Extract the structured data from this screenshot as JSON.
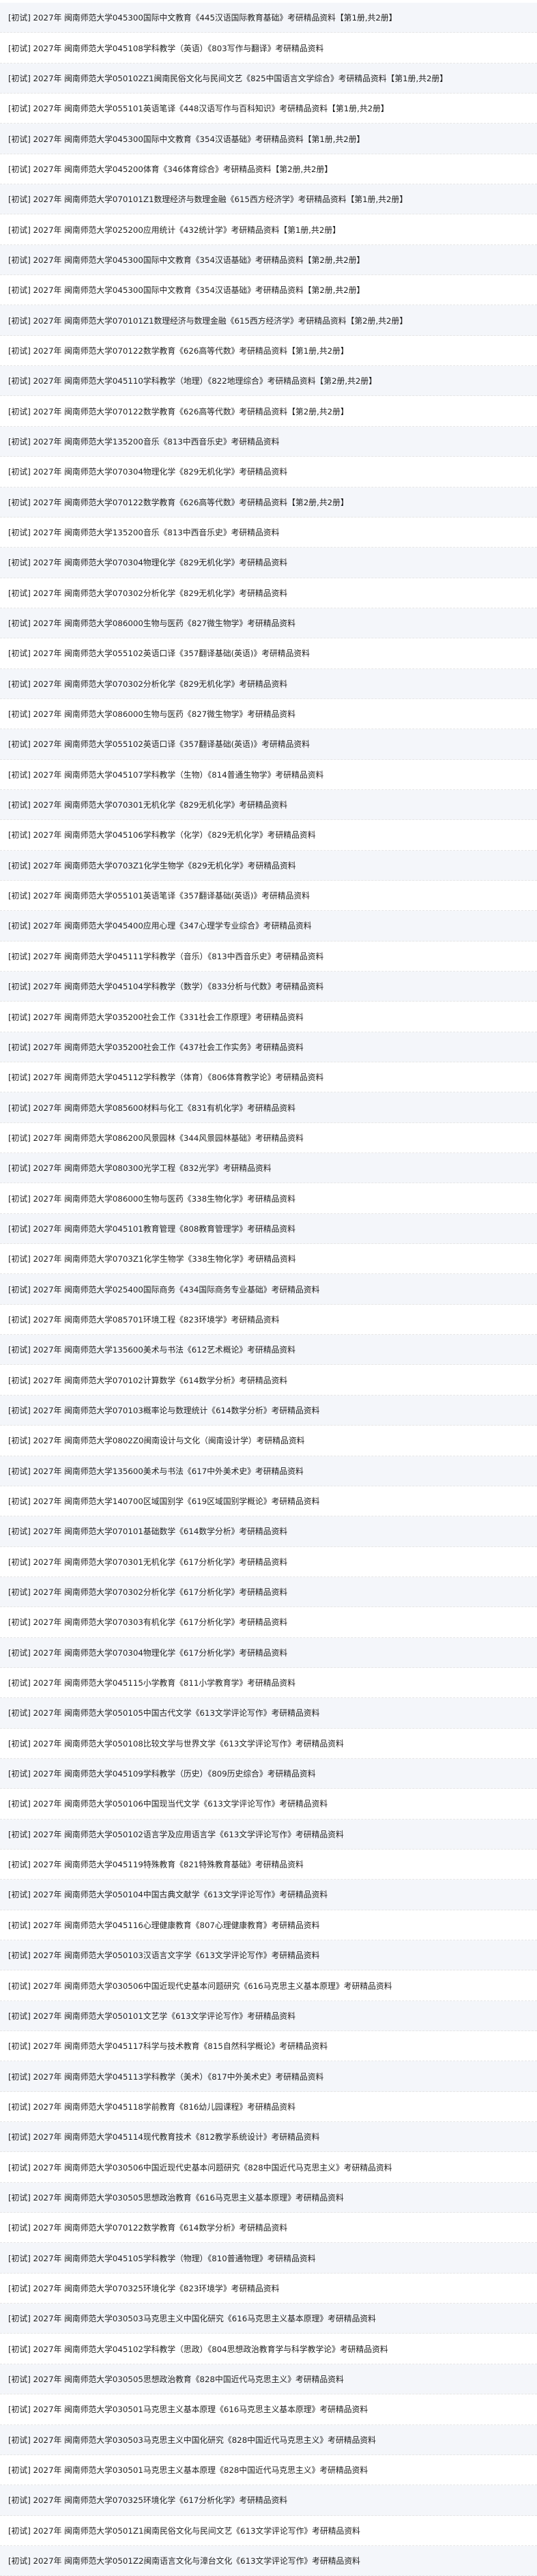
{
  "list": {
    "items": [
      "[初试] 2027年 闽南师范大学045300国际中文教育《445汉语国际教育基础》考研精品资料【第1册,共2册】",
      "[初试] 2027年 闽南师范大学045108学科教学（英语）《803写作与翻译》考研精品资料",
      "[初试] 2027年 闽南师范大学050102Z1闽南民俗文化与民间文艺《825中国语言文学综合》考研精品资料【第1册,共2册】",
      "[初试] 2027年 闽南师范大学055101英语笔译《448汉语写作与百科知识》考研精品资料【第1册,共2册】",
      "[初试] 2027年 闽南师范大学045300国际中文教育《354汉语基础》考研精品资料【第1册,共2册】",
      "[初试] 2027年 闽南师范大学045200体育《346体育综合》考研精品资料【第2册,共2册】",
      "[初试] 2027年 闽南师范大学070101Z1数理经济与数理金融《615西方经济学》考研精品资料【第1册,共2册】",
      "[初试] 2027年 闽南师范大学025200应用统计《432统计学》考研精品资料【第1册,共2册】",
      "[初试] 2027年 闽南师范大学045300国际中文教育《354汉语基础》考研精品资料【第2册,共2册】",
      "[初试] 2027年 闽南师范大学045300国际中文教育《354汉语基础》考研精品资料【第2册,共2册】",
      "[初试] 2027年 闽南师范大学070101Z1数理经济与数理金融《615西方经济学》考研精品资料【第2册,共2册】",
      "[初试] 2027年 闽南师范大学070122数学教育《626高等代数》考研精品资料【第1册,共2册】",
      "[初试] 2027年 闽南师范大学045110学科教学（地理）《822地理综合》考研精品资料【第2册,共2册】",
      "[初试] 2027年 闽南师范大学070122数学教育《626高等代数》考研精品资料【第2册,共2册】",
      "[初试] 2027年 闽南师范大学135200音乐《813中西音乐史》考研精品资料",
      "[初试] 2027年 闽南师范大学070304物理化学《829无机化学》考研精品资料",
      "[初试] 2027年 闽南师范大学070122数学教育《626高等代数》考研精品资料【第2册,共2册】",
      "[初试] 2027年 闽南师范大学135200音乐《813中西音乐史》考研精品资料",
      "[初试] 2027年 闽南师范大学070304物理化学《829无机化学》考研精品资料",
      "[初试] 2027年 闽南师范大学070302分析化学《829无机化学》考研精品资料",
      "[初试] 2027年 闽南师范大学086000生物与医药《827微生物学》考研精品资料",
      "[初试] 2027年 闽南师范大学055102英语口译《357翻译基础(英语)》考研精品资料",
      "[初试] 2027年 闽南师范大学070302分析化学《829无机化学》考研精品资料",
      "[初试] 2027年 闽南师范大学086000生物与医药《827微生物学》考研精品资料",
      "[初试] 2027年 闽南师范大学055102英语口译《357翻译基础(英语)》考研精品资料",
      "[初试] 2027年 闽南师范大学045107学科教学（生物）《814普通生物学》考研精品资料",
      "[初试] 2027年 闽南师范大学070301无机化学《829无机化学》考研精品资料",
      "[初试] 2027年 闽南师范大学045106学科教学（化学）《829无机化学》考研精品资料",
      "[初试] 2027年 闽南师范大学0703Z1化学生物学《829无机化学》考研精品资料",
      "[初试] 2027年 闽南师范大学055101英语笔译《357翻译基础(英语)》考研精品资料",
      "[初试] 2027年 闽南师范大学045400应用心理《347心理学专业综合》考研精品资料",
      "[初试] 2027年 闽南师范大学045111学科教学（音乐）《813中西音乐史》考研精品资料",
      "[初试] 2027年 闽南师范大学045104学科教学（数学）《833分析与代数》考研精品资料",
      "[初试] 2027年 闽南师范大学035200社会工作《331社会工作原理》考研精品资料",
      "[初试] 2027年 闽南师范大学035200社会工作《437社会工作实务》考研精品资料",
      "[初试] 2027年 闽南师范大学045112学科教学（体育）《806体育教学论》考研精品资料",
      "[初试] 2027年 闽南师范大学085600材料与化工《831有机化学》考研精品资料",
      "[初试] 2027年 闽南师范大学086200风景园林《344风景园林基础》考研精品资料",
      "[初试] 2027年 闽南师范大学080300光学工程《832光学》考研精品资料",
      "[初试] 2027年 闽南师范大学086000生物与医药《338生物化学》考研精品资料",
      "[初试] 2027年 闽南师范大学045101教育管理《808教育管理学》考研精品资料",
      "[初试] 2027年 闽南师范大学0703Z1化学生物学《338生物化学》考研精品资料",
      "[初试] 2027年 闽南师范大学025400国际商务《434国际商务专业基础》考研精品资料",
      "[初试] 2027年 闽南师范大学085701环境工程《823环境学》考研精品资料",
      "[初试] 2027年 闽南师范大学135600美术与书法《612艺术概论》考研精品资料",
      "[初试] 2027年 闽南师范大学070102计算数学《614数学分析》考研精品资料",
      "[初试] 2027年 闽南师范大学070103概率论与数理统计《614数学分析》考研精品资料",
      "[初试] 2027年 闽南师范大学0802Z0闽南设计与文化（闽南设计学）考研精品资料",
      "[初试] 2027年 闽南师范大学135600美术与书法《617中外美术史》考研精品资料",
      "[初试] 2027年 闽南师范大学140700区域国别学《619区域国别学概论》考研精品资料",
      "[初试] 2027年 闽南师范大学070101基础数学《614数学分析》考研精品资料",
      "[初试] 2027年 闽南师范大学070301无机化学《617分析化学》考研精品资料",
      "[初试] 2027年 闽南师范大学070302分析化学《617分析化学》考研精品资料",
      "[初试] 2027年 闽南师范大学070303有机化学《617分析化学》考研精品资料",
      "[初试] 2027年 闽南师范大学070304物理化学《617分析化学》考研精品资料",
      "[初试] 2027年 闽南师范大学045115小学教育《811小学教育学》考研精品资料",
      "[初试] 2027年 闽南师范大学050105中国古代文学《613文学评论写作》考研精品资料",
      "[初试] 2027年 闽南师范大学050108比较文学与世界文学《613文学评论写作》考研精品资料",
      "[初试] 2027年 闽南师范大学045109学科教学（历史）《809历史综合》考研精品资料",
      "[初试] 2027年 闽南师范大学050106中国现当代文学《613文学评论写作》考研精品资料",
      "[初试] 2027年 闽南师范大学050102语言学及应用语言学《613文学评论写作》考研精品资料",
      "[初试] 2027年 闽南师范大学045119特殊教育《821特殊教育基础》考研精品资料",
      "[初试] 2027年 闽南师范大学050104中国古典文献学《613文学评论写作》考研精品资料",
      "[初试] 2027年 闽南师范大学045116心理健康教育《807心理健康教育》考研精品资料",
      "[初试] 2027年 闽南师范大学050103汉语言文字学《613文学评论写作》考研精品资料",
      "[初试] 2027年 闽南师范大学030506中国近现代史基本问题研究《616马克思主义基本原理》考研精品资料",
      "[初试] 2027年 闽南师范大学050101文艺学《613文学评论写作》考研精品资料",
      "[初试] 2027年 闽南师范大学045117科学与技术教育《815自然科学概论》考研精品资料",
      "[初试] 2027年 闽南师范大学045113学科教学（美术）《817中外美术史》考研精品资料",
      "[初试] 2027年 闽南师范大学045118学前教育《816幼儿园课程》考研精品资料",
      "[初试] 2027年 闽南师范大学045114现代教育技术《812教学系统设计》考研精品资料",
      "[初试] 2027年 闽南师范大学030506中国近现代史基本问题研究《828中国近代马克思主义》考研精品资料",
      "[初试] 2027年 闽南师范大学030505思想政治教育《616马克思主义基本原理》考研精品资料",
      "[初试] 2027年 闽南师范大学070122数学教育《614数学分析》考研精品资料",
      "[初试] 2027年 闽南师范大学045105学科教学（物理）《810普通物理》考研精品资料",
      "[初试] 2027年 闽南师范大学070325环境化学《823环境学》考研精品资料",
      "[初试] 2027年 闽南师范大学030503马克思主义中国化研究《616马克思主义基本原理》考研精品资料",
      "[初试] 2027年 闽南师范大学045102学科教学（思政）《804思想政治教育学与科学教学论》考研精品资料",
      "[初试] 2027年 闽南师范大学030505思想政治教育《828中国近代马克思主义》考研精品资料",
      "[初试] 2027年 闽南师范大学030501马克思主义基本原理《616马克思主义基本原理》考研精品资料",
      "[初试] 2027年 闽南师范大学030503马克思主义中国化研究《828中国近代马克思主义》考研精品资料",
      "[初试] 2027年 闽南师范大学030501马克思主义基本原理《828中国近代马克思主义》考研精品资料",
      "[初试] 2027年 闽南师范大学070325环境化学《617分析化学》考研精品资料",
      "[初试] 2027年 闽南师范大学0501Z1闽南民俗文化与民间文艺《613文学评论写作》考研精品资料",
      "[初试] 2027年 闽南师范大学0501Z2闽南语言文化与漳台文化《613文学评论写作》考研精品资料"
    ]
  }
}
